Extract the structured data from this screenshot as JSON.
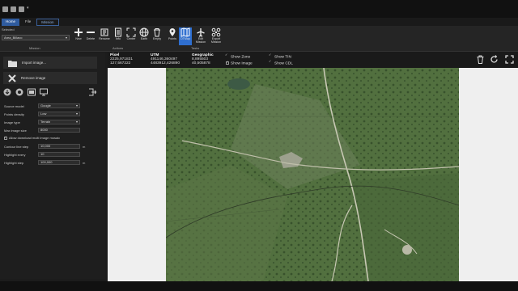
{
  "tabs": [
    "Home",
    "File",
    "Mission"
  ],
  "selected": {
    "label": "Selected",
    "value": "Area_Billavo"
  },
  "ribbon": {
    "mission_buttons": [
      "New",
      "Delete",
      "Rename",
      "Info",
      "Center",
      "Earth",
      "Empty"
    ],
    "task_buttons": [
      "Points",
      "DTMap",
      "Edit Mission",
      "Export Mission"
    ],
    "groups": [
      "Mission",
      "Actions",
      "Tasks"
    ],
    "active_button": "DTMap"
  },
  "left": {
    "import_label": "Import image...",
    "remove_label": "Remove image",
    "props": [
      {
        "label": "Source model",
        "value": "Google",
        "dropdown": true
      },
      {
        "label": "Points density",
        "value": "Low",
        "dropdown": true
      },
      {
        "label": "Image type",
        "value": "Terrain",
        "dropdown": true
      },
      {
        "label": "Max image size",
        "value": "8000",
        "dropdown": false
      }
    ],
    "allow_label": "Allow download multi image mosaic",
    "contour_label": "Contour line step",
    "contour_value": "10,000",
    "contour_unit": "m",
    "highlight_every_label": "Highlight every",
    "highlight_every_value": "10",
    "highlight_step_label": "Highlight step",
    "highlight_step_value": "100,000",
    "highlight_step_unit": "m"
  },
  "status": {
    "pixel_label": "Pixel",
    "pixel_x": "2225,971831",
    "pixel_y": "127,567222",
    "utm_label": "UTM",
    "utm_x": "491146,360497",
    "utm_y": "4483912,426890",
    "geo_label": "Geographic",
    "geo_x": "8,895503",
    "geo_y": "40,505878",
    "show_zone": "Show Zone",
    "show_image": "Show Image",
    "show_tin": "Show TIN",
    "show_cdl": "Show CDL"
  },
  "colors": {
    "accent": "#2f6fd0",
    "tab_active": "#2f5b9e",
    "map_green": "#4e6b3e"
  }
}
